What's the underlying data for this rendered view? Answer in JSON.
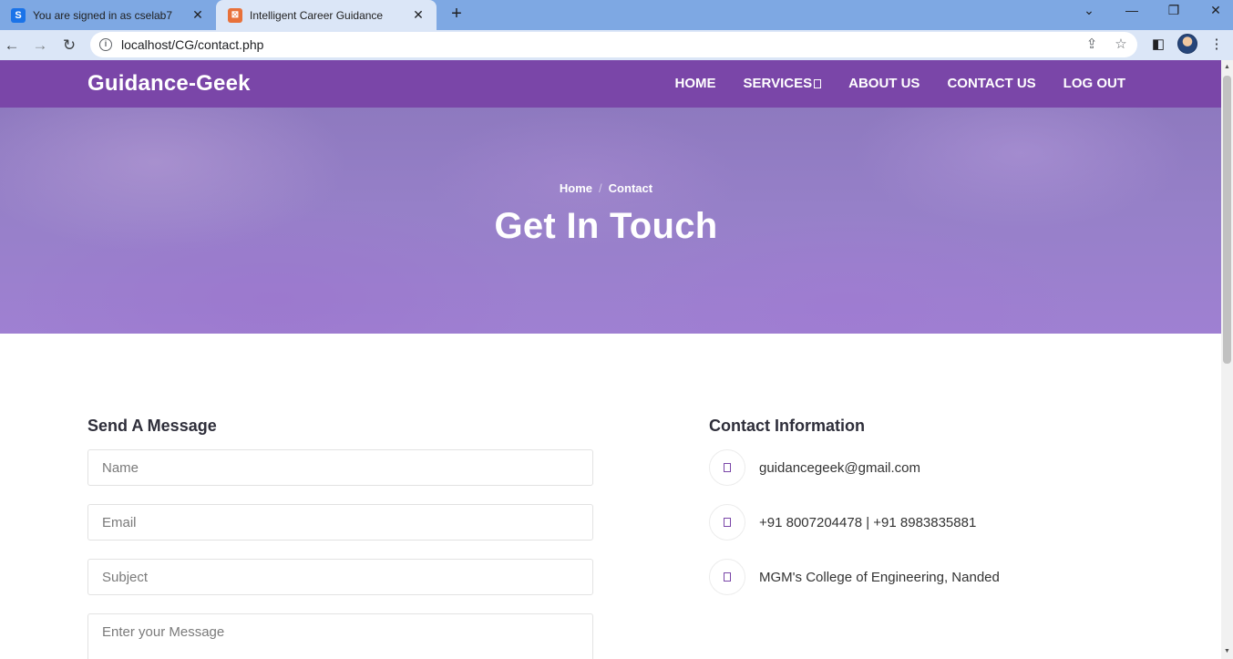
{
  "browser": {
    "tabs": [
      {
        "favicon": "S",
        "title": "You are signed in as cselab7"
      },
      {
        "favicon": "XAMPP",
        "title": "Intelligent Career Guidance"
      }
    ],
    "url": "localhost/CG/contact.php"
  },
  "site": {
    "brand": "Guidance-Geek",
    "menu": [
      "HOME",
      "SERVICES",
      "ABOUT US",
      "CONTACT US",
      "LOG OUT"
    ],
    "accent_color": "#7a46a8"
  },
  "hero": {
    "breadcrumb": [
      "Home",
      "Contact"
    ],
    "title": "Get In Touch"
  },
  "form": {
    "heading": "Send A Message",
    "placeholders": {
      "name": "Name",
      "email": "Email",
      "subject": "Subject",
      "message": "Enter your Message"
    }
  },
  "contact": {
    "heading": "Contact Information",
    "items": [
      {
        "icon": "envelope-icon",
        "text": "guidancegeek@gmail.com"
      },
      {
        "icon": "phone-icon",
        "text": "+91 8007204478 | +91 8983835881"
      },
      {
        "icon": "location-icon",
        "text": "MGM's College of Engineering, Nanded"
      }
    ]
  }
}
